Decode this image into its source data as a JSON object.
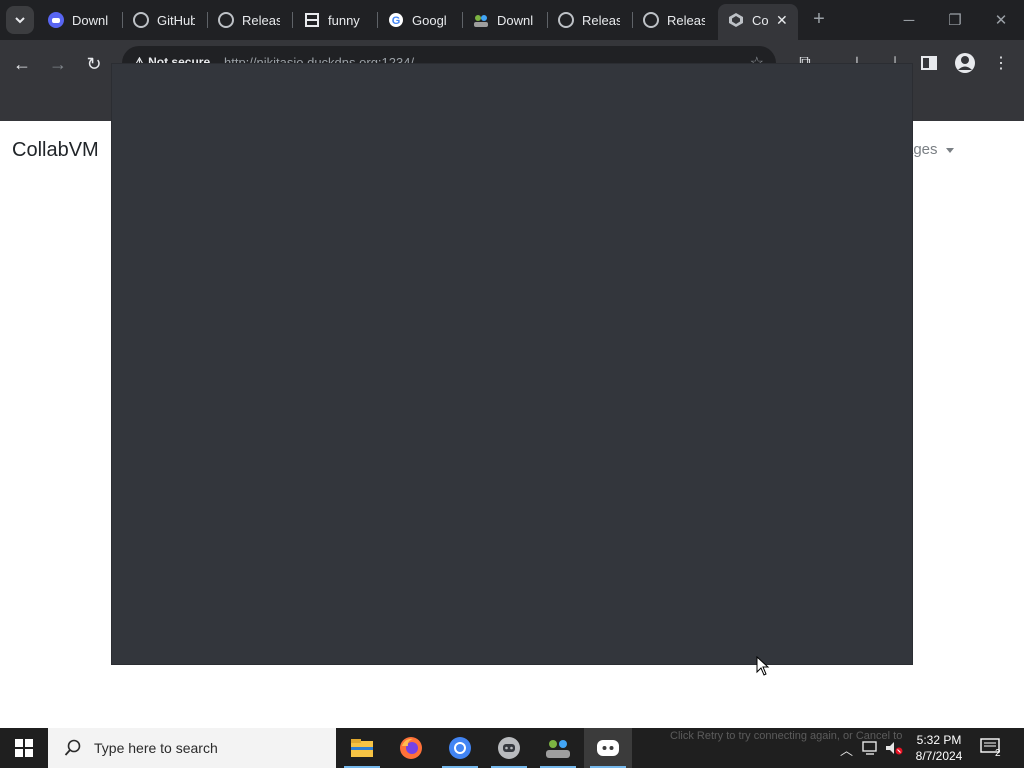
{
  "browser": {
    "tabs": [
      {
        "title": "Downl",
        "icon": "discord-icon"
      },
      {
        "title": "GitHub",
        "icon": "github-icon"
      },
      {
        "title": "Releas",
        "icon": "github-icon"
      },
      {
        "title": "funny",
        "icon": "meme-icon"
      },
      {
        "title": "Googl",
        "icon": "google-icon"
      },
      {
        "title": "Downl",
        "icon": "people-icon"
      },
      {
        "title": "Releas",
        "icon": "github-icon"
      },
      {
        "title": "Releas",
        "icon": "github-icon"
      },
      {
        "title": "Co",
        "icon": "collabvm-icon",
        "active": true
      }
    ],
    "address": {
      "security_label": "Not secure",
      "url": "http://nikitasio.duckdns.org:1234/"
    }
  },
  "page": {
    "brand": "CollabVM",
    "nav_item": "ages"
  },
  "taskbar": {
    "search_placeholder": "Type here to search",
    "background_message": "Click Retry to try connecting again, or Cancel to",
    "time": "5:32 PM",
    "date": "8/7/2024",
    "notification_count": "2",
    "apps": [
      "file-explorer-icon",
      "firefox-icon",
      "chromium-icon",
      "discord-icon",
      "people-icon",
      "discord-icon"
    ]
  },
  "colors": {
    "chrome_dark": "#202124",
    "toolbar": "#35363a",
    "overlay": "#33363c",
    "taskbar": "#1f1f1f"
  }
}
